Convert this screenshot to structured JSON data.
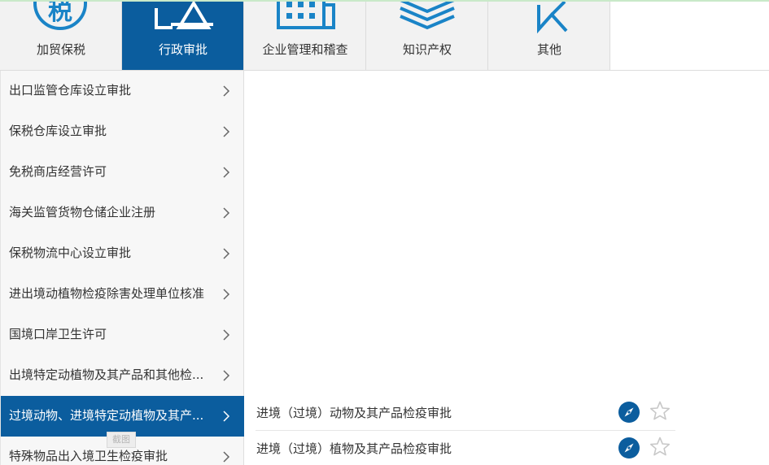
{
  "tabs": [
    {
      "label": "加贸保税",
      "icon": "tax-icon",
      "active": false
    },
    {
      "label": "行政审批",
      "icon": "approval-icon",
      "active": true
    },
    {
      "label": "企业管理和稽查",
      "icon": "building-icon",
      "active": false
    },
    {
      "label": "知识产权",
      "icon": "layers-icon",
      "active": false
    },
    {
      "label": "其他",
      "icon": "check-icon",
      "active": false
    }
  ],
  "tab_icon_text": "税",
  "sidebar": {
    "items": [
      {
        "label": "出口监管仓库设立审批"
      },
      {
        "label": "保税仓库设立审批"
      },
      {
        "label": "免税商店经营许可"
      },
      {
        "label": "海关监管货物仓储企业注册"
      },
      {
        "label": "保税物流中心设立审批"
      },
      {
        "label": "进出境动植物检疫除害处理单位核准"
      },
      {
        "label": "国境口岸卫生许可"
      },
      {
        "label": "出境特定动植物及其产品和其他检..."
      },
      {
        "label": "过境动物、进境特定动植物及其产..."
      },
      {
        "label": "特殊物品出入境卫生检疫审批"
      }
    ],
    "active_index": 8
  },
  "chip_label": "截图",
  "sublist": {
    "items": [
      {
        "label": "进境（过境）动物及其产品检疫审批"
      },
      {
        "label": "进境（过境）植物及其产品检疫审批"
      }
    ]
  },
  "colors": {
    "primary": "#0b5d9e",
    "tab_bg": "#f2f2f2",
    "sidebar_bg": "#f7f7f7",
    "star": "#c8c8c8"
  }
}
